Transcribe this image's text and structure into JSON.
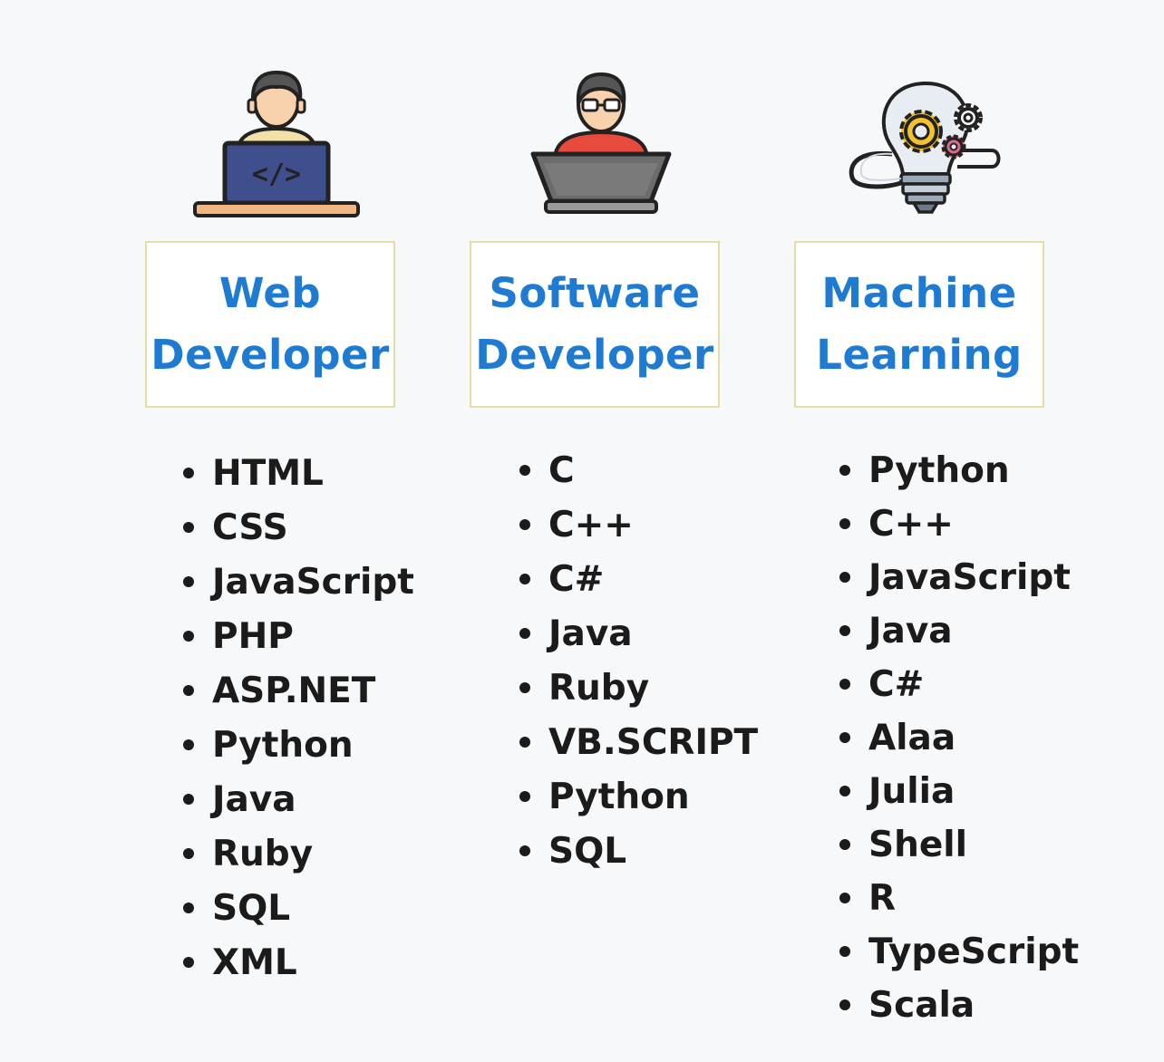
{
  "columns": [
    {
      "id": "web",
      "icon": "web-developer-icon",
      "title_lines": [
        "Web",
        "Developer"
      ],
      "items": [
        "HTML",
        "CSS",
        "JavaScript",
        "PHP",
        "ASP.NET",
        "Python",
        "Java",
        "Ruby",
        "SQL",
        "XML"
      ]
    },
    {
      "id": "software",
      "icon": "software-developer-icon",
      "title_lines": [
        "Software",
        "Developer"
      ],
      "items": [
        "C",
        "C++",
        "C#",
        "Java",
        "Ruby",
        "VB.SCRIPT",
        "Python",
        "SQL"
      ]
    },
    {
      "id": "ml",
      "icon": "machine-learning-icon",
      "title_lines": [
        "Machine",
        "Learning"
      ],
      "items": [
        "Python",
        "C++",
        "JavaScript",
        "Java",
        "C#",
        "Alaa",
        "Julia",
        "Shell",
        "R",
        "TypeScript",
        "Scala"
      ]
    }
  ],
  "colors": {
    "title": "#1f7bd1",
    "box_border": "#e6dca8",
    "text": "#1b1b1b",
    "background": "#f7f8fa"
  }
}
